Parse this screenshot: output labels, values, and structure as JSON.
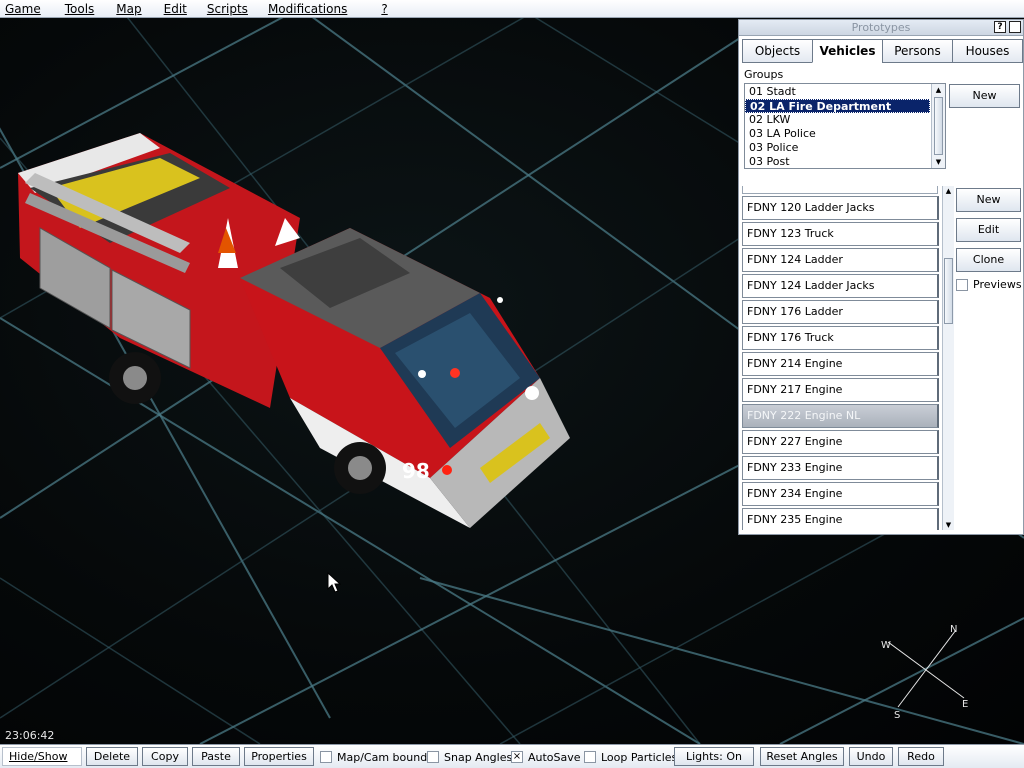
{
  "menu": [
    "Game",
    "Tools",
    "Map",
    "Edit",
    "Scripts",
    "Modifications",
    "?"
  ],
  "panel": {
    "title": "Prototypes",
    "help_btn": "?",
    "tabs": [
      "Objects",
      "Vehicles",
      "Persons",
      "Houses"
    ],
    "active_tab": "Vehicles",
    "groups_label": "Groups",
    "groups": [
      "01 Stadt",
      "02 LA Fire Department",
      "02 LKW",
      "03 LA Police",
      "03 Police",
      "03 Post"
    ],
    "selected_group": "02 LA Fire Department",
    "group_new_btn": "New",
    "vehicles": [
      "FDNY 120 Ladder Jacks",
      "FDNY 123 Truck",
      "FDNY 124 Ladder",
      "FDNY 124 Ladder Jacks",
      "FDNY 176 Ladder",
      "FDNY 176 Truck",
      "FDNY 214 Engine",
      "FDNY 217 Engine",
      "FDNY 222 Engine NL",
      "FDNY 227 Engine",
      "FDNY 233 Engine",
      "FDNY 234 Engine",
      "FDNY 235 Engine"
    ],
    "selected_vehicle": "FDNY 222 Engine NL",
    "vehicle_buttons": {
      "new": "New",
      "edit": "Edit",
      "clone": "Clone"
    },
    "previews_label": "Previews",
    "previews_checked": false
  },
  "viewport": {
    "clock": "23:06:42",
    "compass": {
      "n": "N",
      "e": "E",
      "s": "S",
      "w": "W"
    },
    "truck_number": "98"
  },
  "toolbar": {
    "hide_show": "Hide/Show",
    "delete": "Delete",
    "copy": "Copy",
    "paste": "Paste",
    "properties": "Properties",
    "map_cam_bounds": "Map/Cam bounds",
    "map_cam_bounds_checked": false,
    "snap_angles": "Snap Angles",
    "snap_angles_checked": false,
    "autosave": "AutoSave",
    "autosave_checked": true,
    "loop_particles": "Loop Particles",
    "loop_particles_checked": false,
    "lights": "Lights: On",
    "reset_angles": "Reset Angles",
    "undo": "Undo",
    "redo": "Redo",
    "check_mark": "×"
  },
  "colors": {
    "selection": "#0a246a",
    "grid": "#4a7a86",
    "truck_red": "#b0141a"
  }
}
